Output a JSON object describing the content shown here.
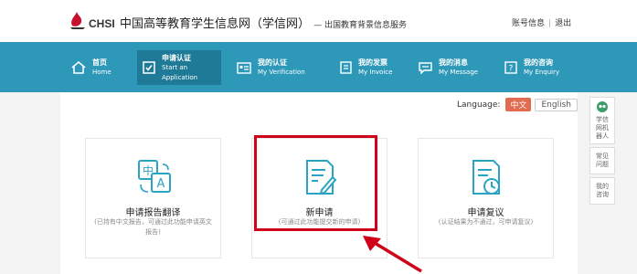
{
  "header": {
    "logo_text": "CHSI",
    "site_title": "中国高等教育学生信息网（学信网）",
    "site_subtitle": "— 出国教育背景信息服务",
    "user_links": [
      "账号信息",
      "退出"
    ]
  },
  "nav": {
    "items": [
      {
        "cn": "首页",
        "en": "Home",
        "icon": "home-icon"
      },
      {
        "cn": "申请认证",
        "en": "Start an Application",
        "icon": "checkbox-icon"
      },
      {
        "cn": "我的认证",
        "en": "My Verification",
        "icon": "id-card-icon"
      },
      {
        "cn": "我的发票",
        "en": "My Invoice",
        "icon": "invoice-icon"
      },
      {
        "cn": "我的消息",
        "en": "My Message",
        "icon": "message-icon"
      },
      {
        "cn": "我的咨询",
        "en": "My Enquiry",
        "icon": "enquiry-icon"
      }
    ],
    "active_index": 1
  },
  "language": {
    "label": "Language:",
    "options": [
      "中文",
      "English"
    ],
    "selected": "中文"
  },
  "cards": [
    {
      "title": "申请报告翻译",
      "desc": "(已持有中文报告，可通过此功能申请英文报告)",
      "icon": "translate-icon"
    },
    {
      "title": "新申请",
      "desc": "(可通过此功能提交新的申请)",
      "icon": "new-document-icon"
    },
    {
      "title": "申请复议",
      "desc": "(认证结果为不通过，可申请复议)",
      "icon": "review-document-icon"
    }
  ],
  "side": {
    "items": [
      "学信网机器人",
      "常见问题",
      "我的咨询"
    ]
  },
  "colors": {
    "nav_bg": "#2e98b8",
    "nav_active": "#1f7a97",
    "icon_teal": "#2ba3c5",
    "highlight": "#d0021b",
    "lang_active": "#e06b50"
  }
}
